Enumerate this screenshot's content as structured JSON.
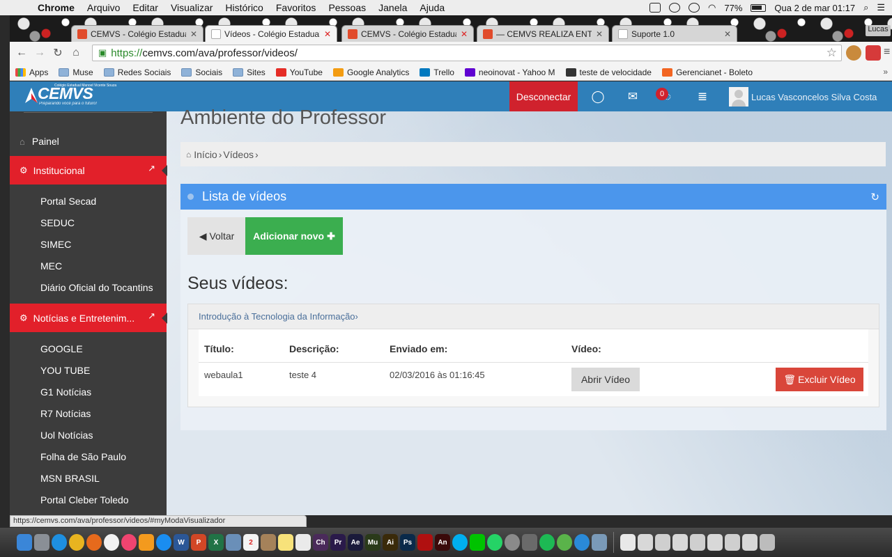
{
  "menubar": {
    "app": "Chrome",
    "items": [
      "Arquivo",
      "Editar",
      "Visualizar",
      "Histórico",
      "Favoritos",
      "Pessoas",
      "Janela",
      "Ajuda"
    ],
    "battery": "77%",
    "datetime": "Qua 2 de mar  01:17"
  },
  "browser": {
    "tabs": [
      {
        "label": "CEMVS - Colégio Estadual",
        "active": false
      },
      {
        "label": "Vídeos - Colégio Estadual",
        "active": true
      },
      {
        "label": "CEMVS - Colégio Estadual",
        "active": false
      },
      {
        "label": "— CEMVS REALIZA ENTRE",
        "active": false
      },
      {
        "label": "Suporte 1.0",
        "active": false
      }
    ],
    "profile": "Lucas",
    "url_scheme": "https://",
    "url_rest": "cemvs.com/ava/professor/videos/",
    "bookmarks": [
      "Apps",
      "Muse",
      "Redes Sociais",
      "Sociais",
      "Sites",
      "YouTube",
      "Google Analytics",
      "Trello",
      "neoinovat - Yahoo M",
      "teste de velocidade",
      "Gerencianet - Boleto"
    ],
    "status_url": "https://cemvs.com/ava/professor/videos/#myModaVisualizador"
  },
  "site": {
    "logo_main": "CEMVS",
    "logo_pre": "Colégio Estadual Manoel Vicente Souza",
    "logo_tagline": "Preparando você para o futuro!",
    "disconnect": "Desconectar",
    "notif_count": "0",
    "user_name": "Lucas Vasconcelos Silva Costa"
  },
  "sidebar": {
    "painel": "Painel",
    "section1": "Institucional",
    "links1": [
      "Portal Secad",
      "SEDUC",
      "SIMEC",
      "MEC",
      "Diário Oficial do Tocantins"
    ],
    "section2": "Notícias e Entretenim...",
    "links2": [
      "GOOGLE",
      "YOU TUBE",
      "G1 Notícias",
      "R7 Notícias",
      "Uol Notícias",
      "Folha de São Paulo",
      "MSN BRASIL",
      "Portal Cleber Toledo"
    ]
  },
  "content": {
    "title": "Ambiente do Professor",
    "crumb_home": "Início",
    "crumb_current": "Vídeos",
    "panel_title": "Lista de vídeos",
    "btn_back": "Voltar",
    "btn_add": "Adicionar novo",
    "section_title": "Seus vídeos:",
    "course": "Introdução à Tecnologia da Informação",
    "headers": {
      "titulo": "Título:",
      "descricao": "Descrição:",
      "enviado": "Enviado em:",
      "video": "Vídeo:"
    },
    "row": {
      "titulo": "webaula1",
      "descricao": "teste 4",
      "enviado": "02/03/2016 às 01:16:45"
    },
    "btn_open": "Abrir Vídeo",
    "btn_delete": "Excluir Vídeo"
  },
  "colors": {
    "header_blue": "#2f7fb9",
    "panel_blue": "#4b96ec",
    "red": "#e2202a",
    "green": "#3bae4f",
    "delete_red": "#d9463a"
  }
}
